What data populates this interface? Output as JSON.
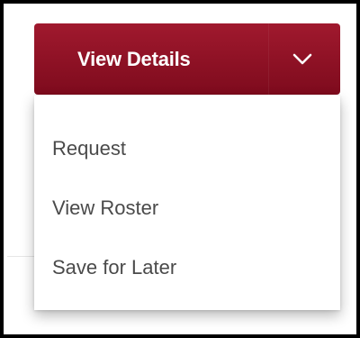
{
  "dropdown": {
    "label": "View Details",
    "icon": "chevron-down-icon",
    "colors": {
      "background_top": "#a0192e",
      "background_bottom": "#7e0b1d",
      "text": "#ffffff"
    }
  },
  "menu": {
    "items": [
      {
        "label": "Request"
      },
      {
        "label": "View Roster"
      },
      {
        "label": "Save for Later"
      }
    ]
  }
}
